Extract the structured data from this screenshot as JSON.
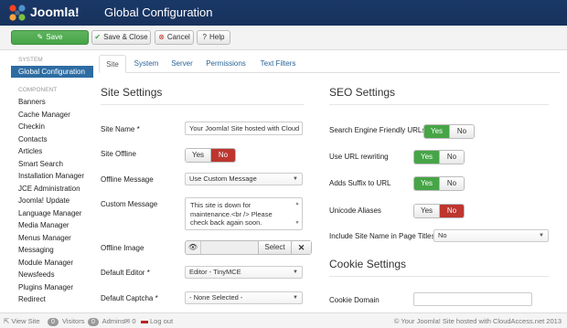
{
  "header": {
    "brand": "Joomla!",
    "title": "Global Configuration"
  },
  "toolbar": {
    "save_label": "Save",
    "save_close_label": "Save & Close",
    "cancel_label": "Cancel",
    "help_label": "Help"
  },
  "sidebar": {
    "system_heading": "SYSTEM",
    "active_item": "Global Configuration",
    "component_heading": "COMPONENT",
    "items": [
      "Banners",
      "Cache Manager",
      "Checkin",
      "Contacts",
      "Articles",
      "Smart Search",
      "Installation Manager",
      "JCE Administration",
      "Joomla! Update",
      "Language Manager",
      "Media Manager",
      "Menus Manager",
      "Messaging",
      "Module Manager",
      "Newsfeeds",
      "Plugins Manager",
      "Redirect"
    ]
  },
  "tabs": [
    "Site",
    "System",
    "Server",
    "Permissions",
    "Text Filters"
  ],
  "site_settings": {
    "title": "Site Settings",
    "site_name_label": "Site Name *",
    "site_name_value": "Your Joomla! Site hosted with Cloud",
    "site_offline_label": "Site Offline",
    "yes": "Yes",
    "no": "No",
    "offline_message_label": "Offline Message",
    "offline_message_value": "Use Custom Message",
    "custom_message_label": "Custom Message",
    "custom_message_lines": [
      "This site is down for",
      "maintenance.<br /> Please",
      "check back again soon."
    ],
    "offline_image_label": "Offline Image",
    "select_label": "Select",
    "default_editor_label": "Default Editor *",
    "default_editor_value": "Editor - TinyMCE",
    "default_captcha_label": "Default Captcha *",
    "default_captcha_value": "- None Selected -"
  },
  "seo_settings": {
    "title": "SEO Settings",
    "sef_label": "Search Engine Friendly URLs",
    "rewrite_label": "Use URL rewriting",
    "suffix_label": "Adds Suffix to URL",
    "unicode_label": "Unicode Aliases",
    "include_name_label": "Include Site Name in Page Titles",
    "include_name_value": "No",
    "yes": "Yes",
    "no": "No"
  },
  "cookie_settings": {
    "title": "Cookie Settings",
    "domain_label": "Cookie Domain",
    "domain_value": ""
  },
  "footer": {
    "view_site": "View Site",
    "visitors_count": "0",
    "visitors": "Visitors",
    "admins_count": "0",
    "admins": "Admins",
    "messages_count": "0",
    "log_out": "Log out",
    "copyright": "© Your Joomla! Site hosted with CloudAccess.net 2013"
  },
  "colors": {
    "header_bg": "#1a3867",
    "save_green": "#46a546",
    "no_red": "#bd362f",
    "active_blue": "#2d6ca2"
  }
}
